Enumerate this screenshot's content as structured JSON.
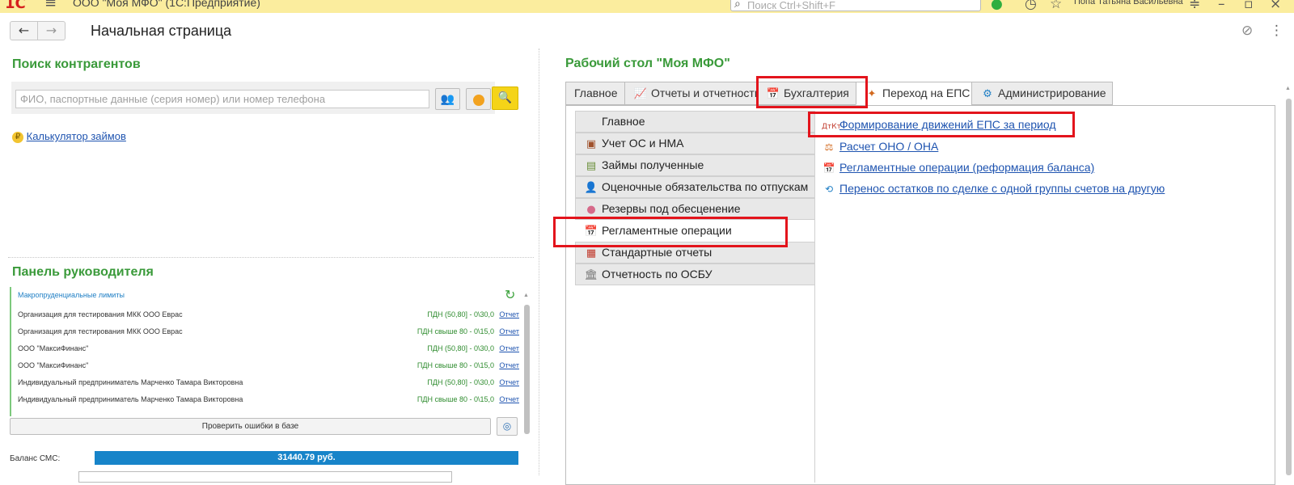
{
  "topbar": {
    "logo": "1С",
    "app_title": "ООО \"Моя МФО\" (1С:Предприятие)",
    "search_placeholder": "Поиск Ctrl+Shift+F",
    "user": "Попа Татьяна Васильевна"
  },
  "nav": {
    "back": "←",
    "forward": "→",
    "page_title": "Начальная страница"
  },
  "search_section": {
    "title": "Поиск контрагентов",
    "input_placeholder": "ФИО, паспортные данные (серия номер) или номер телефона"
  },
  "calc_link": "Калькулятор займов",
  "manager_panel": {
    "title": "Панель руководителя",
    "header": "Макропруденциальные лимиты",
    "rows": [
      {
        "org": "Организация для тестирования МКК ООО Еврас",
        "value": "ПДН (50,80] - 0\\30,0",
        "report": "Отчет"
      },
      {
        "org": "Организация для тестирования МКК ООО Еврас",
        "value": "ПДН свыше 80 - 0\\15,0",
        "report": "Отчет"
      },
      {
        "org": "ООО \"МаксиФинанс\"",
        "value": "ПДН (50,80] - 0\\30,0",
        "report": "Отчет"
      },
      {
        "org": "ООО \"МаксиФинанс\"",
        "value": "ПДН свыше 80 - 0\\15,0",
        "report": "Отчет"
      },
      {
        "org": "Индивидуальный предприниматель Марченко Тамара Викторовна",
        "value": "ПДН (50,80] - 0\\30,0",
        "report": "Отчет"
      },
      {
        "org": "Индивидуальный предприниматель Марченко Тамара Викторовна",
        "value": "ПДН свыше 80 - 0\\15,0",
        "report": "Отчет"
      }
    ],
    "check_button": "Проверить ошибки в базе",
    "sms_label": "Баланс СМС:",
    "sms_value": "31440.79 руб."
  },
  "desktop": {
    "title": "Рабочий стол \"Моя МФО\"",
    "tabs": [
      {
        "label": "Главное"
      },
      {
        "label": "Отчеты и отчетность"
      },
      {
        "label": "Бухгалтерия"
      },
      {
        "label": "Переход на ЕПС"
      },
      {
        "label": "Администрирование"
      }
    ],
    "left_nav": [
      {
        "label": "Главное"
      },
      {
        "label": "Учет ОС и НМА"
      },
      {
        "label": "Займы полученные"
      },
      {
        "label": "Оценочные обязательства по отпускам"
      },
      {
        "label": "Резервы под обесценение"
      },
      {
        "label": "Регламентные операции"
      },
      {
        "label": "Стандартные отчеты"
      },
      {
        "label": "Отчетность по ОСБУ"
      }
    ],
    "commands": [
      {
        "label": "Формирование движений ЕПС за период"
      },
      {
        "label": "Расчет ОНО / ОНА"
      },
      {
        "label": "Регламентные операции (реформация баланса)"
      },
      {
        "label": "Перенос остатков по сделке с одной группы счетов на другую"
      }
    ]
  },
  "colors": {
    "accent_green": "#3a9a3a",
    "link_blue": "#1f54b0",
    "highlight_red": "#e3141c",
    "topbar_yellow": "#fbed9e",
    "sms_bar_blue": "#1784c9"
  }
}
